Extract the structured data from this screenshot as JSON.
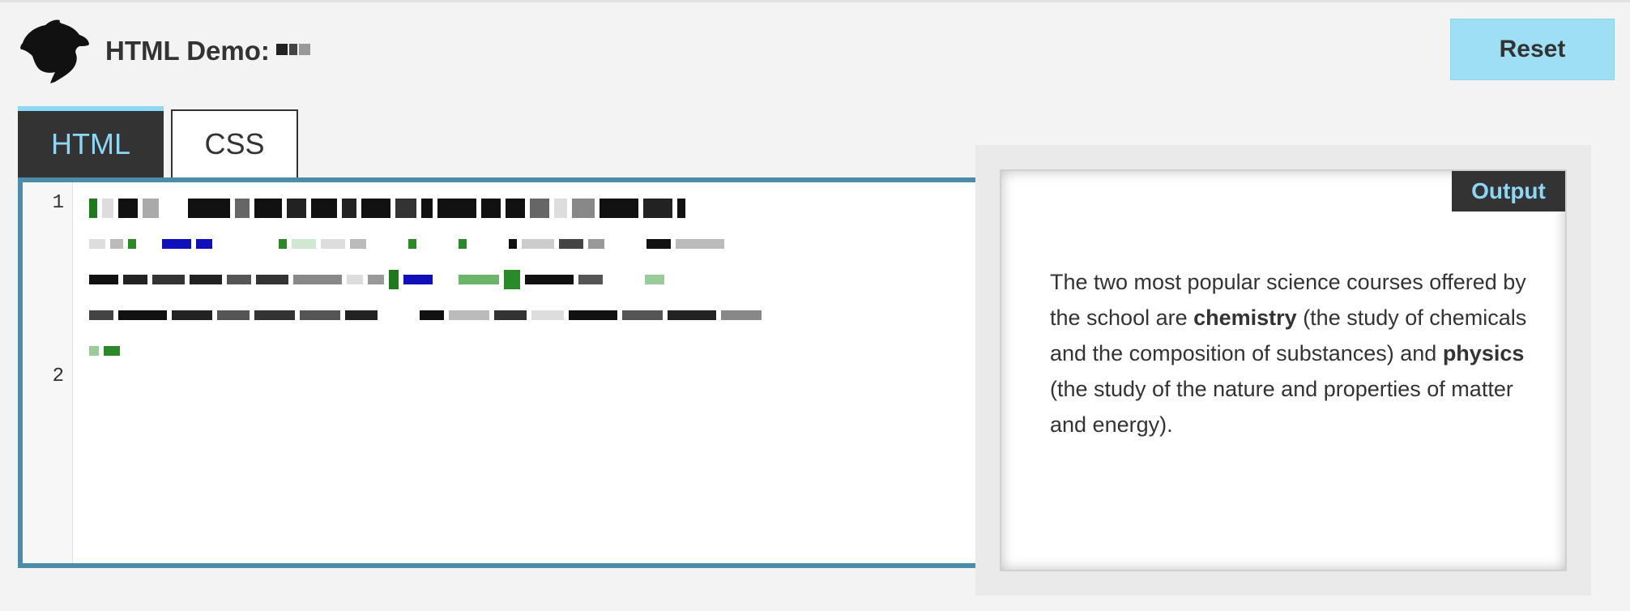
{
  "header": {
    "title": "HTML Demo:",
    "reset_label": "Reset"
  },
  "tabs": [
    {
      "label": "HTML",
      "active": true
    },
    {
      "label": "CSS",
      "active": false
    }
  ],
  "editor": {
    "line_numbers": [
      "1",
      "2"
    ]
  },
  "output": {
    "badge": "Output",
    "paragraph": {
      "part1": "The two most popular science courses offered by the school are ",
      "bold1": "chemistry",
      "part2": " (the study of chemicals and the composition of substances) and ",
      "bold2": "physics",
      "part3": " (the study of the nature and properties of matter and energy)."
    }
  },
  "colors": {
    "accent": "#8cd7f4",
    "reset_bg": "#9fdff5",
    "editor_border": "#4c8ca8",
    "dark": "#333333"
  }
}
